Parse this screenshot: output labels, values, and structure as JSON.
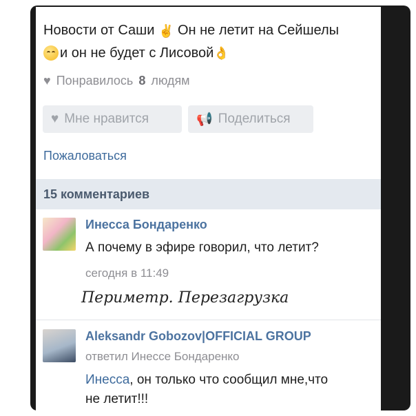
{
  "post": {
    "line1_a": "Новости от Саши",
    "line1_b": "Он не летит на Сейшелы",
    "line2": "и он не будет с Лисовой",
    "emoji_victory": "victory-hand-icon",
    "emoji_smile": "smiling-face-icon",
    "emoji_ok": "ok-hand-icon"
  },
  "likes": {
    "prefix": "Понравилось",
    "count": "8",
    "suffix": "людям"
  },
  "actions": {
    "like_label": "Мне нравится",
    "share_label": "Поделиться",
    "report_label": "Пожаловаться"
  },
  "comments": {
    "header": "15 комментариев",
    "items": [
      {
        "author": "Инесса Бондаренко",
        "text": "А почему в эфире говорил, что летит?",
        "time": "сегодня в 11:49"
      },
      {
        "author": "Aleksandr Gobozov|OFFICIAL GROUP",
        "reply_to": "ответил Инессе Бондаренко",
        "mention": "Инесса",
        "text": ", он только что сообщил мне,что",
        "text2": "не летит!!!"
      }
    ]
  },
  "watermark": "Периметр. Перезагрузка",
  "colors": {
    "link": "#3d6a9c",
    "author": "#4c73a0",
    "header_bg": "#e4e9ef",
    "button_bg": "#eceef1"
  }
}
